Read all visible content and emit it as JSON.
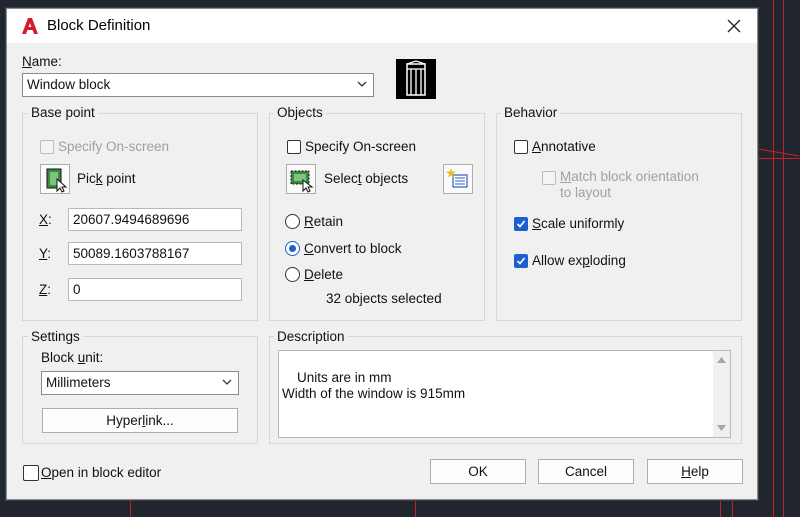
{
  "dialog": {
    "title": "Block Definition",
    "close_icon": "close-icon",
    "app_icon": "autocad-logo"
  },
  "name_section": {
    "label_u": "N",
    "label_rest": "ame:",
    "value": "Window block",
    "preview_icon": "window-block-preview"
  },
  "base_point": {
    "title": "Base point",
    "specify_onscreen": "Specify On-screen",
    "pick_point_a": "Pic",
    "pick_point_u": "k",
    "pick_point_b": " point",
    "x_label": "X",
    "x_value": "20607.9494689696",
    "y_label": "Y",
    "y_value": "50089.1603788167",
    "z_label": "Z",
    "z_value": "0"
  },
  "objects": {
    "title": "Objects",
    "specify_onscreen": "Specify On-screen",
    "select_objects_a": "Selec",
    "select_objects_u": "t",
    "select_objects_b": " objects",
    "retain_u": "R",
    "retain_rest": "etain",
    "convert_u": "C",
    "convert_rest": "onvert to block",
    "delete_u": "D",
    "delete_rest": "elete",
    "status": "32 objects selected",
    "selected_option": "convert"
  },
  "behavior": {
    "title": "Behavior",
    "annotative_u": "A",
    "annotative_rest": "nnotative",
    "annotative_checked": false,
    "match_u": "M",
    "match_rest": "atch block orientation",
    "match_line2": "to layout",
    "scale_u": "S",
    "scale_rest": "cale uniformly",
    "scale_checked": true,
    "explode_a": "Allow ex",
    "explode_u": "p",
    "explode_b": "loding",
    "explode_checked": true
  },
  "settings": {
    "title": "Settings",
    "block_unit_a": "Block ",
    "block_unit_u": "u",
    "block_unit_b": "nit:",
    "unit_value": "Millimeters",
    "hyperlink_a": "Hyper",
    "hyperlink_u": "l",
    "hyperlink_b": "ink..."
  },
  "description": {
    "title": "Description",
    "text": "Units are in mm\nWidth of the window is 915mm"
  },
  "footer": {
    "open_editor_u": "O",
    "open_editor_rest": "pen in block editor",
    "ok": "OK",
    "cancel": "Cancel",
    "help_u": "H",
    "help_rest": "elp"
  },
  "colors": {
    "accent": "#1d5fd0",
    "background_canvas": "#21262e",
    "cad_line": "#c8202b"
  }
}
